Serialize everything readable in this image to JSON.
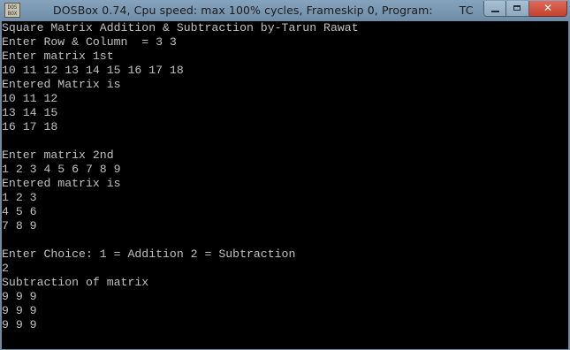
{
  "window": {
    "icon_label": "DOS BOX",
    "title": "DOSBox 0.74, Cpu speed: max 100% cycles, Frameskip  0, Program:",
    "program": "TC",
    "close_symbol": "✕"
  },
  "console": {
    "lines": [
      "Square Matrix Addition & Subtraction by-Tarun Rawat",
      "Enter Row & Column  = 3 3",
      "Enter matrix 1st",
      "10 11 12 13 14 15 16 17 18",
      "Entered Matrix is",
      "10 11 12",
      "13 14 15",
      "16 17 18",
      "",
      "Enter matrix 2nd",
      "1 2 3 4 5 6 7 8 9",
      "Entered matrix is",
      "1 2 3",
      "4 5 6",
      "7 8 9",
      "",
      "Enter Choice: 1 = Addition 2 = Subtraction",
      "2",
      "Subtraction of matrix",
      "9 9 9",
      "9 9 9",
      "9 9 9"
    ]
  }
}
